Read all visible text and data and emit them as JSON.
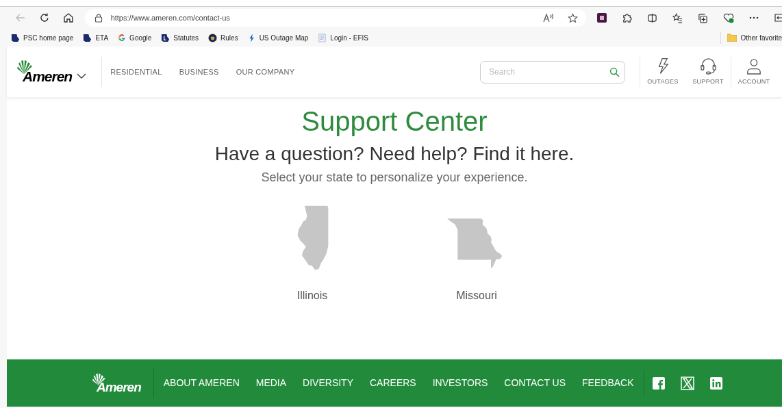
{
  "browser": {
    "url": "https://www.ameren.com/contact-us",
    "bookmarks": [
      {
        "label": "PSC home page",
        "kind": "state"
      },
      {
        "label": "ETA",
        "kind": "state"
      },
      {
        "label": "Google",
        "kind": "google"
      },
      {
        "label": "Statutes",
        "kind": "statutes"
      },
      {
        "label": "Rules",
        "kind": "rules"
      },
      {
        "label": "US Outage Map",
        "kind": "bolt"
      },
      {
        "label": "Login - EFIS",
        "kind": "doc"
      }
    ],
    "other_favorites": "Other favorite"
  },
  "header": {
    "logo": "Ameren",
    "nav": [
      "RESIDENTIAL",
      "BUSINESS",
      "OUR COMPANY"
    ],
    "search": {
      "placeholder": "Search"
    },
    "actions": [
      {
        "label": "OUTAGES",
        "kind": "bolt"
      },
      {
        "label": "SUPPORT",
        "kind": "headset"
      },
      {
        "label": "ACCOUNT",
        "kind": "person"
      }
    ]
  },
  "main": {
    "title": "Support Center",
    "subtitle": "Have a question? Need help? Find it here.",
    "prompt": "Select your state to personalize your experience.",
    "states": [
      {
        "label": "Illinois",
        "kind": "illinois"
      },
      {
        "label": "Missouri",
        "kind": "missouri"
      }
    ]
  },
  "footer": {
    "logo": "Ameren",
    "links": [
      "ABOUT AMEREN",
      "MEDIA",
      "DIVERSITY",
      "CAREERS",
      "INVESTORS",
      "CONTACT US",
      "FEEDBACK"
    ],
    "social": [
      {
        "kind": "facebook"
      },
      {
        "kind": "x"
      },
      {
        "kind": "linkedin"
      }
    ]
  }
}
